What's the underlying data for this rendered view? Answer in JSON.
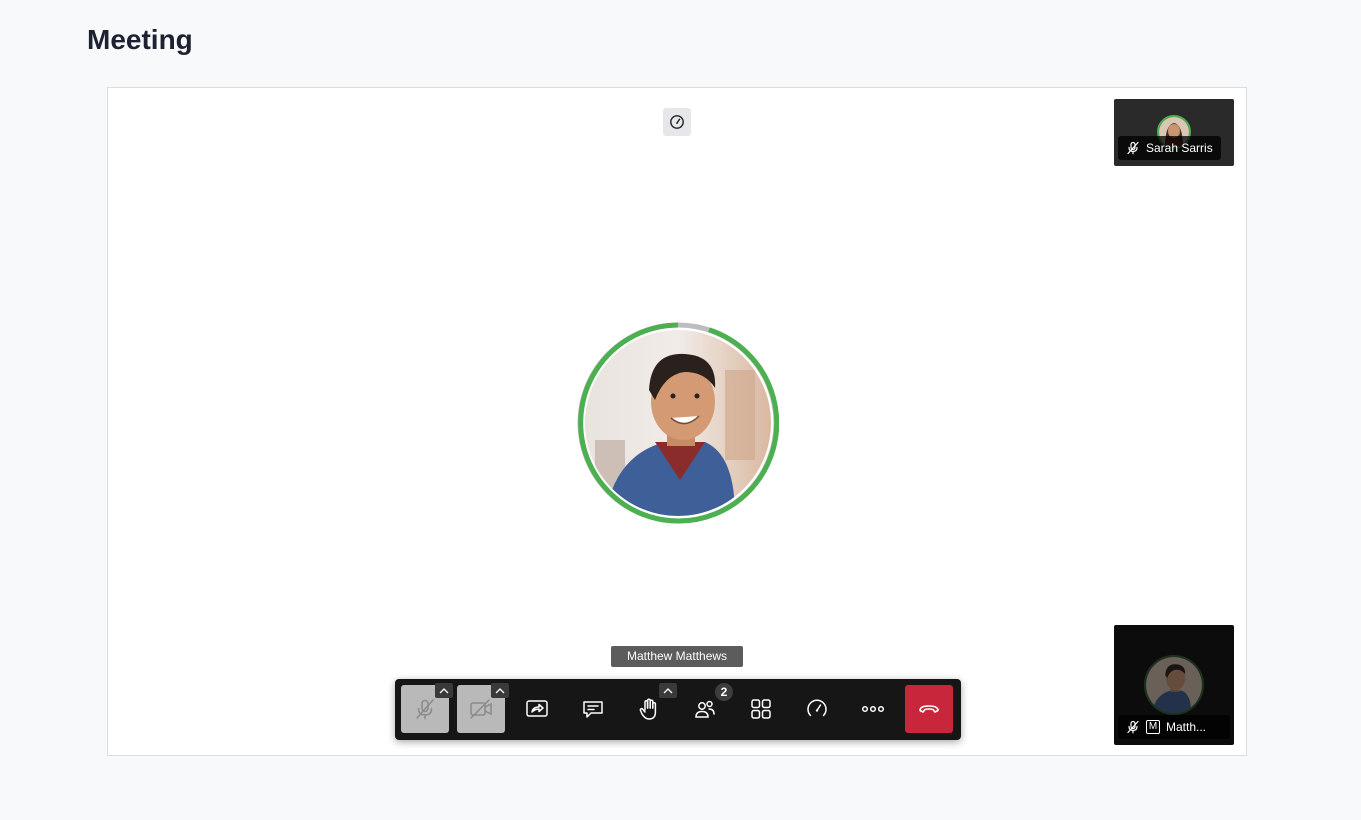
{
  "page": {
    "title": "Meeting"
  },
  "speaker": {
    "name": "Matthew Matthews"
  },
  "participants": [
    {
      "name": "Sarah Sarris",
      "audio": "muted"
    },
    {
      "name": "Matth...",
      "initial": "M",
      "audio": "muted"
    }
  ],
  "toolbar": {
    "buttons": [
      "microphone",
      "camera",
      "share-screen",
      "chat",
      "raise-hand",
      "participants",
      "tile-view",
      "performance-settings",
      "more-actions",
      "leave-meeting"
    ],
    "participants_count": "2"
  },
  "colors": {
    "accent_green": "#4caf50",
    "hangup_red": "#c8263b",
    "toolbar_bg": "#161616"
  }
}
